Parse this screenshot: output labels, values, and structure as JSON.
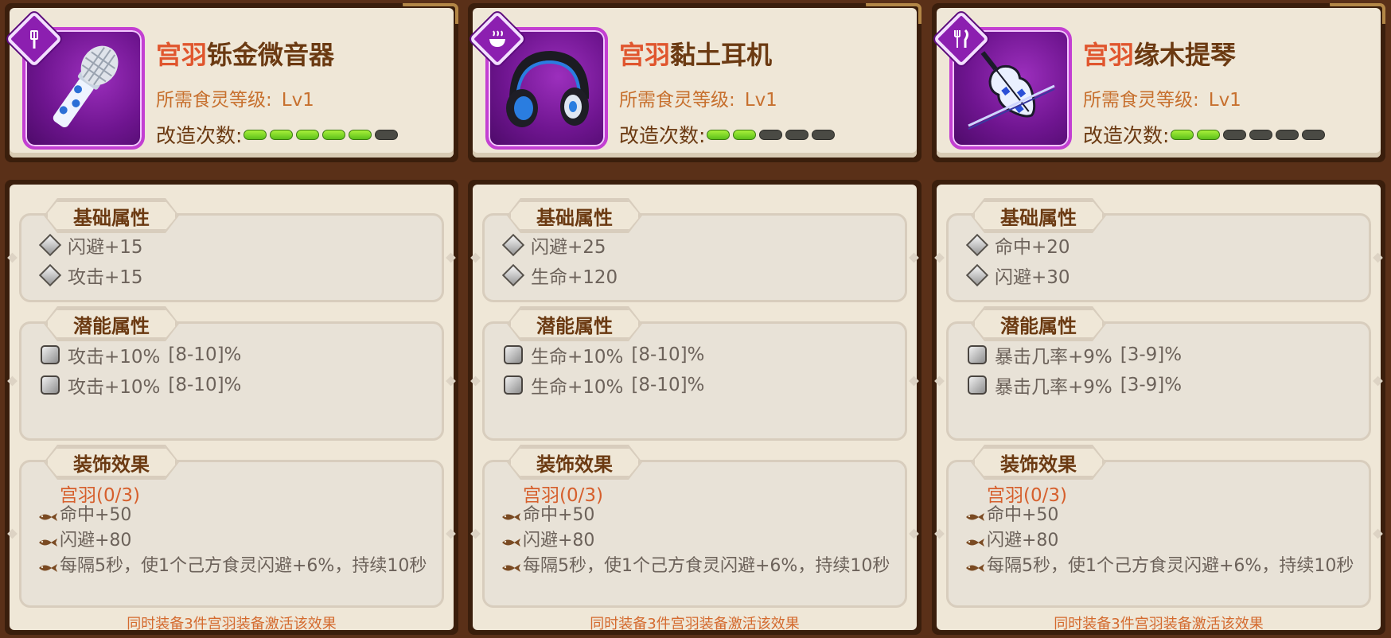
{
  "items": [
    {
      "name_prefix": "宫羽",
      "name_suffix": "铄金微音器",
      "type_icon": "spatula-icon",
      "art_icon": "microphone-icon",
      "level_label": "所需食灵等级:",
      "level_value": "Lv1",
      "refine_label": "改造次数:",
      "refine_filled": 5,
      "refine_total": 6,
      "basic_title": "基础属性",
      "basic": [
        "闪避+15",
        "攻击+15"
      ],
      "potential_title": "潜能属性",
      "potential": [
        {
          "stat": "攻击+10%",
          "range": "[8-10]%"
        },
        {
          "stat": "攻击+10%",
          "range": "[8-10]%"
        }
      ],
      "deco_title": "装饰效果",
      "set_name": "宫羽(0/3)",
      "effects": [
        "命中+50",
        "闪避+80",
        "每隔5秒，使1个己方食灵闪避+6%，持续10秒"
      ],
      "footnote": "同时装备3件宫羽装备激活该效果"
    },
    {
      "name_prefix": "宫羽",
      "name_suffix": "黏土耳机",
      "type_icon": "rice-bowl-icon",
      "art_icon": "headphones-icon",
      "level_label": "所需食灵等级:",
      "level_value": "Lv1",
      "refine_label": "改造次数:",
      "refine_filled": 2,
      "refine_total": 5,
      "basic_title": "基础属性",
      "basic": [
        "闪避+25",
        "生命+120"
      ],
      "potential_title": "潜能属性",
      "potential": [
        {
          "stat": "生命+10%",
          "range": "[8-10]%"
        },
        {
          "stat": "生命+10%",
          "range": "[8-10]%"
        }
      ],
      "deco_title": "装饰效果",
      "set_name": "宫羽(0/3)",
      "effects": [
        "命中+50",
        "闪避+80",
        "每隔5秒，使1个己方食灵闪避+6%，持续10秒"
      ],
      "footnote": "同时装备3件宫羽装备激活该效果"
    },
    {
      "name_prefix": "宫羽",
      "name_suffix": "缘木提琴",
      "type_icon": "fork-knife-icon",
      "art_icon": "violin-icon",
      "level_label": "所需食灵等级:",
      "level_value": "Lv1",
      "refine_label": "改造次数:",
      "refine_filled": 2,
      "refine_total": 6,
      "basic_title": "基础属性",
      "basic": [
        "命中+20",
        "闪避+30"
      ],
      "potential_title": "潜能属性",
      "potential": [
        {
          "stat": "暴击几率+9%",
          "range": "[3-9]%"
        },
        {
          "stat": "暴击几率+9%",
          "range": "[3-9]%"
        }
      ],
      "deco_title": "装饰效果",
      "set_name": "宫羽(0/3)",
      "effects": [
        "命中+50",
        "闪避+80",
        "每隔5秒，使1个己方食灵闪避+6%，持续10秒"
      ],
      "footnote": "同时装备3件宫羽装备激活该效果"
    }
  ]
}
